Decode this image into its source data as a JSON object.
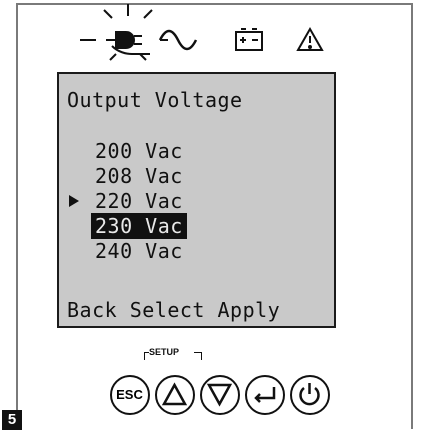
{
  "indicators": {
    "icons": [
      "utility-power-icon",
      "ac-wave-icon",
      "battery-icon",
      "warning-icon"
    ]
  },
  "lcd": {
    "title": "Output Voltage",
    "options": [
      "200 Vac",
      "208 Vac",
      "220 Vac",
      "230 Vac",
      "240 Vac"
    ],
    "cursor_index": 2,
    "selected_index": 3,
    "softkeys": "Back Select Apply"
  },
  "buttons": {
    "setup_label": "SETUP",
    "esc_label": "ESC",
    "icons": [
      "esc-button",
      "up-arrow-icon",
      "down-arrow-icon",
      "enter-icon",
      "power-icon"
    ]
  },
  "figure": {
    "number": "5"
  },
  "colors": {
    "lcd_background": "#c9c9c9",
    "text": "#111111",
    "panel_border": "#7a7a7a"
  }
}
